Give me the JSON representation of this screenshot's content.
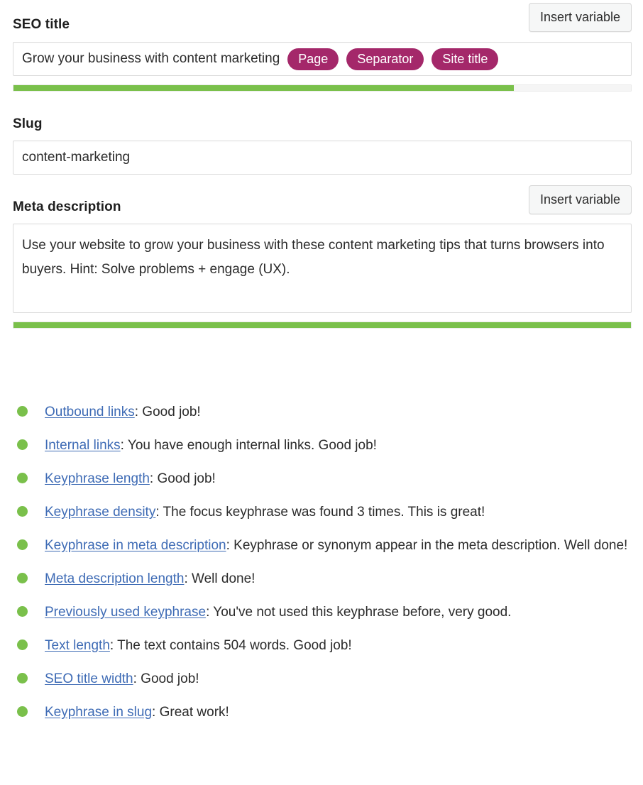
{
  "seo_title": {
    "label": "SEO title",
    "insert_variable_label": "Insert variable",
    "value": "Grow your business with content marketing",
    "pills": [
      "Page",
      "Separator",
      "Site title"
    ],
    "progress_percent": 81
  },
  "slug": {
    "label": "Slug",
    "value": "content-marketing"
  },
  "meta_description": {
    "label": "Meta description",
    "insert_variable_label": "Insert variable",
    "value": "Use your website to grow your business with these content marketing tips that turns browsers into buyers. Hint: Solve problems + engage (UX).",
    "progress_percent": 100
  },
  "colors": {
    "good_green": "#7ac04b",
    "pill_magenta": "#a4286a",
    "link_blue": "#3e6bb5"
  },
  "analysis": [
    {
      "status": "good",
      "link": "Outbound links",
      "separator": ": ",
      "text": "Good job!"
    },
    {
      "status": "good",
      "link": "Internal links",
      "separator": ": ",
      "text": "You have enough internal links. Good job!"
    },
    {
      "status": "good",
      "link": "Keyphrase length",
      "separator": ": ",
      "text": "Good job!"
    },
    {
      "status": "good",
      "link": "Keyphrase density",
      "separator": ": ",
      "text": "The focus keyphrase was found 3 times. This is great!"
    },
    {
      "status": "good",
      "link": "Keyphrase in meta description",
      "separator": ": ",
      "text": "Keyphrase or synonym appear in the meta description. Well done!"
    },
    {
      "status": "good",
      "link": "Meta description length",
      "separator": ": ",
      "text": "Well done!"
    },
    {
      "status": "good",
      "link": "Previously used keyphrase",
      "separator": ": ",
      "text": "You've not used this keyphrase before, very good."
    },
    {
      "status": "good",
      "link": "Text length",
      "separator": ": ",
      "text": "The text contains 504 words. Good job!"
    },
    {
      "status": "good",
      "link": "SEO title width",
      "separator": ": ",
      "text": "Good job!"
    },
    {
      "status": "good",
      "link": "Keyphrase in slug",
      "separator": ": ",
      "text": "Great work!"
    }
  ]
}
